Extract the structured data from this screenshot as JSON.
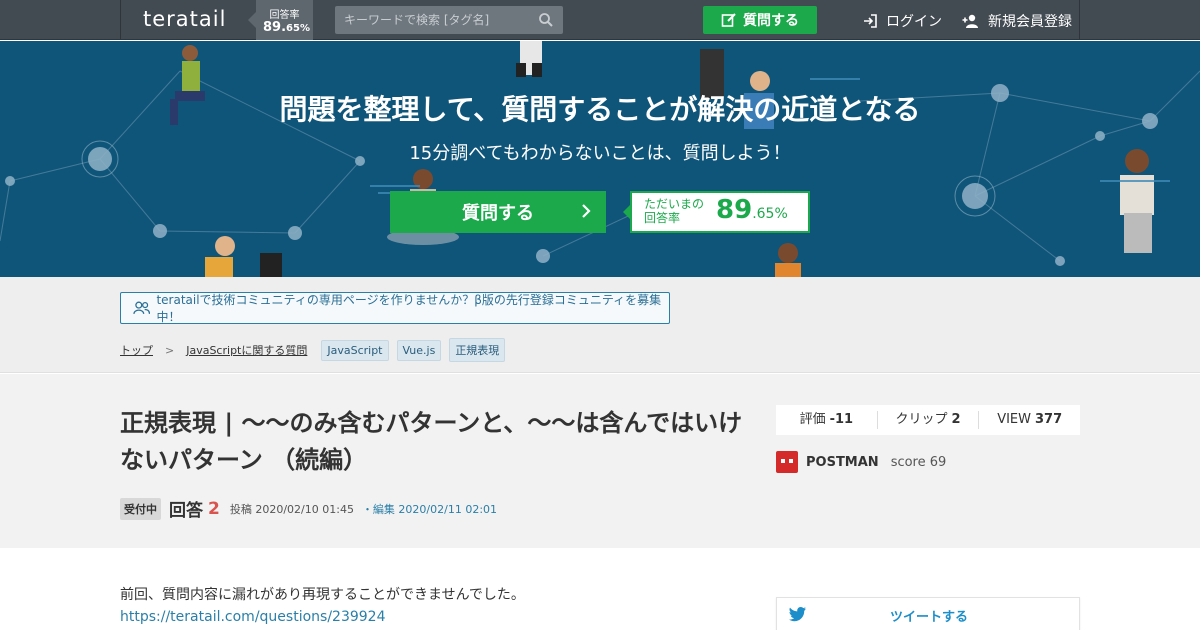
{
  "header": {
    "logo": "teratail",
    "rate_label": "回答率",
    "rate_main": "89.",
    "rate_dec": "65%",
    "search_placeholder": "キーワードで検索 [タグ名]",
    "ask_label": "質問する",
    "login_label": "ログイン",
    "signup_label": "新規会員登録"
  },
  "hero": {
    "title": "問題を整理して、質問することが解決の近道となる",
    "subtitle": "15分調べてもわからないことは、質問しよう！",
    "ask_button": "質問する",
    "rate_label": "ただいまの回答率",
    "rate_main": "89",
    "rate_dec": ".65%"
  },
  "notice": {
    "community": "teratailで技術コミュニティの専用ページを作りませんか？β版の先行登録コミュニティを募集中！"
  },
  "breadcrumb": {
    "top": "トップ",
    "sep": ">",
    "category": "JavaScriptに関する質問",
    "tags": [
      "JavaScript",
      "Vue.js",
      "正規表現"
    ]
  },
  "question": {
    "title": "正規表現 | 〜〜のみ含むパターンと、〜〜は含んではいけないパターン （続編）",
    "status": "受付中",
    "answers_label": "回答",
    "answers_count": "2",
    "posted": "投稿 2020/02/10 01:45",
    "edited": "・編集 2020/02/11 02:01",
    "stats": {
      "rating_label": "評価",
      "rating_value": "-11",
      "clip_label": "クリップ",
      "clip_value": "2",
      "view_label": "VIEW",
      "view_value": "377"
    },
    "user_name": "POSTMAN",
    "user_score": "score 69",
    "body_line1": "前回、質問内容に漏れがあり再現することができませんでした。",
    "body_link": "https://teratail.com/questions/239924",
    "tweet_label": "ツイートする"
  },
  "colors": {
    "topbar": "#424a52",
    "hero": "#0f5579",
    "green": "#1ca94b",
    "link": "#2a7fa8"
  }
}
